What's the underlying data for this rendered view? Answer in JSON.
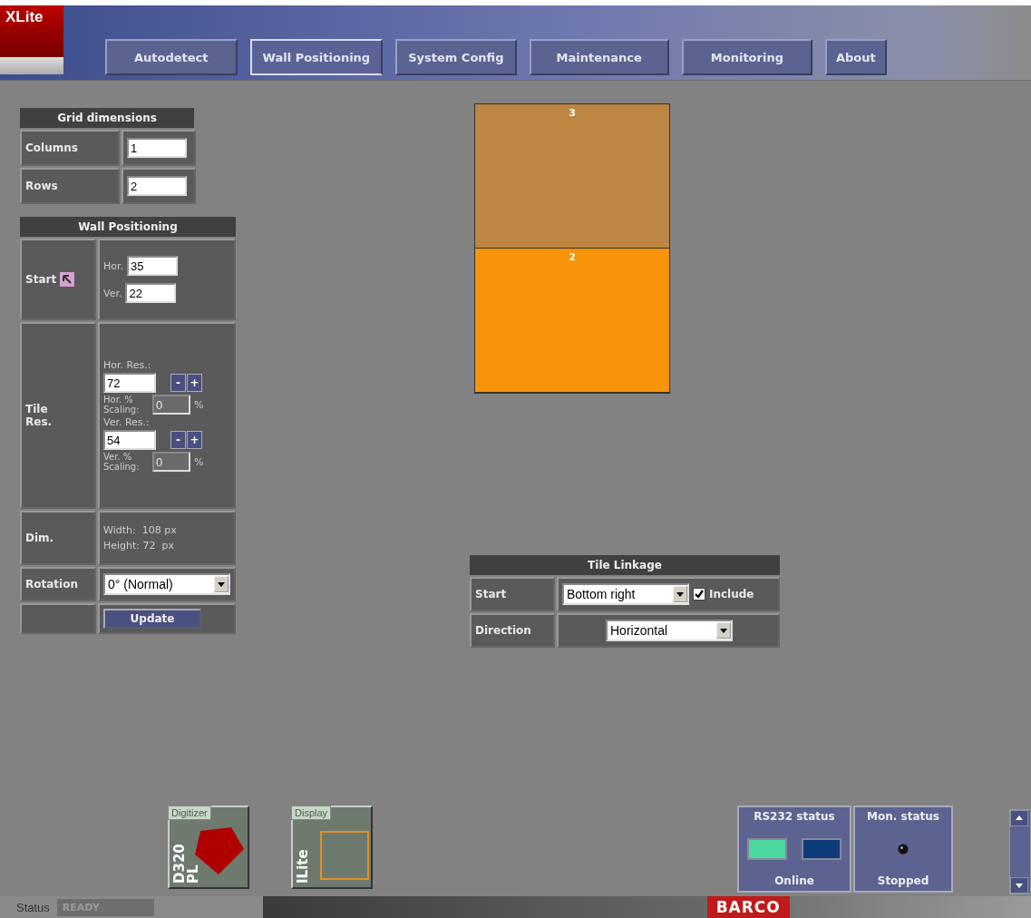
{
  "app": {
    "logo": "XLite"
  },
  "tabs": [
    {
      "label": "Autodetect",
      "selected": false
    },
    {
      "label": "Wall Positioning",
      "selected": true
    },
    {
      "label": "System Config",
      "selected": false
    },
    {
      "label": "Maintenance",
      "selected": false
    },
    {
      "label": "Monitoring",
      "selected": false
    },
    {
      "label": "About",
      "selected": false
    }
  ],
  "grid_dimensions": {
    "title": "Grid dimensions",
    "fields": [
      {
        "label": "Columns",
        "value": "1"
      },
      {
        "label": "Rows",
        "value": "2"
      }
    ]
  },
  "wall_positioning": {
    "title": "Wall Positioning",
    "start": {
      "label": "Start",
      "hor_label": "Hor.",
      "hor_value": "35",
      "ver_label": "Ver.",
      "ver_value": "22"
    },
    "tile_res": {
      "label": "Tile Res.",
      "groups": [
        {
          "res_label": "Hor. Res.:",
          "res_value": "72",
          "minus": "-",
          "plus": "+",
          "scaling_label": "Hor. % Scaling:",
          "scaling_value": "0",
          "percent": "%"
        },
        {
          "res_label": "Ver. Res.:",
          "res_value": "54",
          "minus": "-",
          "plus": "+",
          "scaling_label": "Ver. % Scaling:",
          "scaling_value": "0",
          "percent": "%"
        }
      ]
    },
    "dim": {
      "label": "Dim.",
      "width": "Width:  108 px",
      "height": "Height: 72  px"
    },
    "rotation": {
      "label": "Rotation",
      "value": "0° (Normal)"
    },
    "update_button": "Update"
  },
  "tiles": [
    {
      "label": "3",
      "color": "#bd8642"
    },
    {
      "label": "2",
      "color": "#f7940a"
    }
  ],
  "tile_linkage": {
    "title": "Tile Linkage",
    "start_label": "Start",
    "start_value": "Bottom right",
    "include_label": "Include",
    "include_checked": true,
    "direction_label": "Direction",
    "direction_value": "Horizontal"
  },
  "devices": [
    {
      "kind": "digitizer",
      "tag": "Digitizer",
      "name": "D320 PL"
    },
    {
      "kind": "display",
      "tag": "Display",
      "name": "ILite"
    }
  ],
  "rs232_status": {
    "title": "RS232 status",
    "lights": [
      {
        "color": "#4cd6a0"
      },
      {
        "color": "#0d3a7a"
      }
    ],
    "state": "Online"
  },
  "mon_status": {
    "title": "Mon. status",
    "state": "Stopped"
  },
  "status_bar": {
    "label": "Status",
    "value": "READY",
    "brand": "BARCO"
  }
}
